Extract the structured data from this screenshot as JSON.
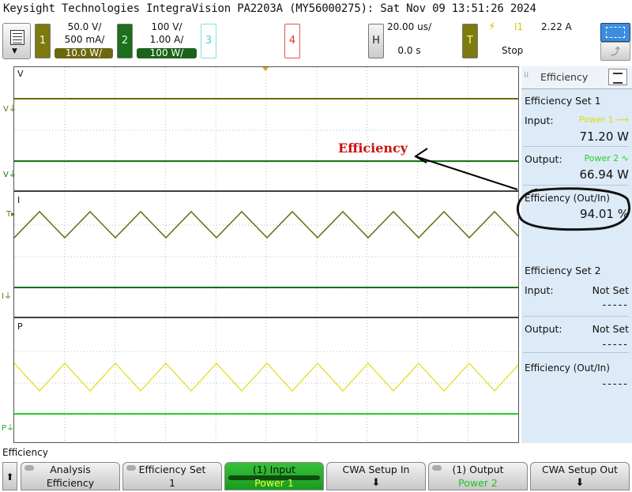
{
  "title": "Keysight Technologies IntegraVision PA2203A (MY56000275): Sat Nov 09 13:51:26 2024",
  "colors": {
    "ch1": "#7d7a10",
    "ch2": "#1e6e1e",
    "ch1_trace": "#6b6a10",
    "ch2_trace": "#157315",
    "yellow": "#e1db0a",
    "green": "#22d322",
    "annotation": "#cc1111"
  },
  "channels": [
    {
      "num": "1",
      "volts": "50.0 V/",
      "amps": "500 mA/",
      "watts": "10.0 W/"
    },
    {
      "num": "2",
      "volts": "100 V/",
      "amps": "1.00 A/",
      "watts": "100 W/"
    },
    {
      "num": "3"
    },
    {
      "num": "4"
    }
  ],
  "horizontal": {
    "label": "H",
    "time_div": "20.00 us/",
    "delay": "0.0 s"
  },
  "trigger": {
    "label": "T",
    "source": "I1",
    "level": "2.22 A",
    "state": "Stop"
  },
  "screen": {
    "v_label": "V",
    "i_label": "I",
    "p_label": "P",
    "annotation": "Efficiency"
  },
  "panel": {
    "header": "Efficiency",
    "set1": {
      "title": "Efficiency Set 1",
      "input_label": "Input:",
      "input_source": "Power 1",
      "input_value": "71.20 W",
      "output_label": "Output:",
      "output_source": "Power 2",
      "output_value": "66.94 W",
      "eff_label": "Efficiency (Out/In)",
      "eff_value": "94.01 %"
    },
    "set2": {
      "title": "Efficiency Set 2",
      "input_label": "Input:",
      "input_value": "Not Set",
      "input_dash": "-----",
      "output_label": "Output:",
      "output_value": "Not Set",
      "output_dash": "-----",
      "eff_label": "Efficiency (Out/In)",
      "eff_dash": "-----"
    }
  },
  "status": "Efficiency",
  "softkeys": [
    {
      "top": "Analysis",
      "bottom": "Efficiency"
    },
    {
      "top": "Efficiency Set",
      "bottom": "1"
    },
    {
      "top": "(1) Input",
      "bottom": "Power 1"
    },
    {
      "top": "CWA Setup In",
      "bottom": ""
    },
    {
      "top": "(1) Output",
      "bottom": "Power 2"
    },
    {
      "top": "CWA Setup Out",
      "bottom": ""
    }
  ]
}
